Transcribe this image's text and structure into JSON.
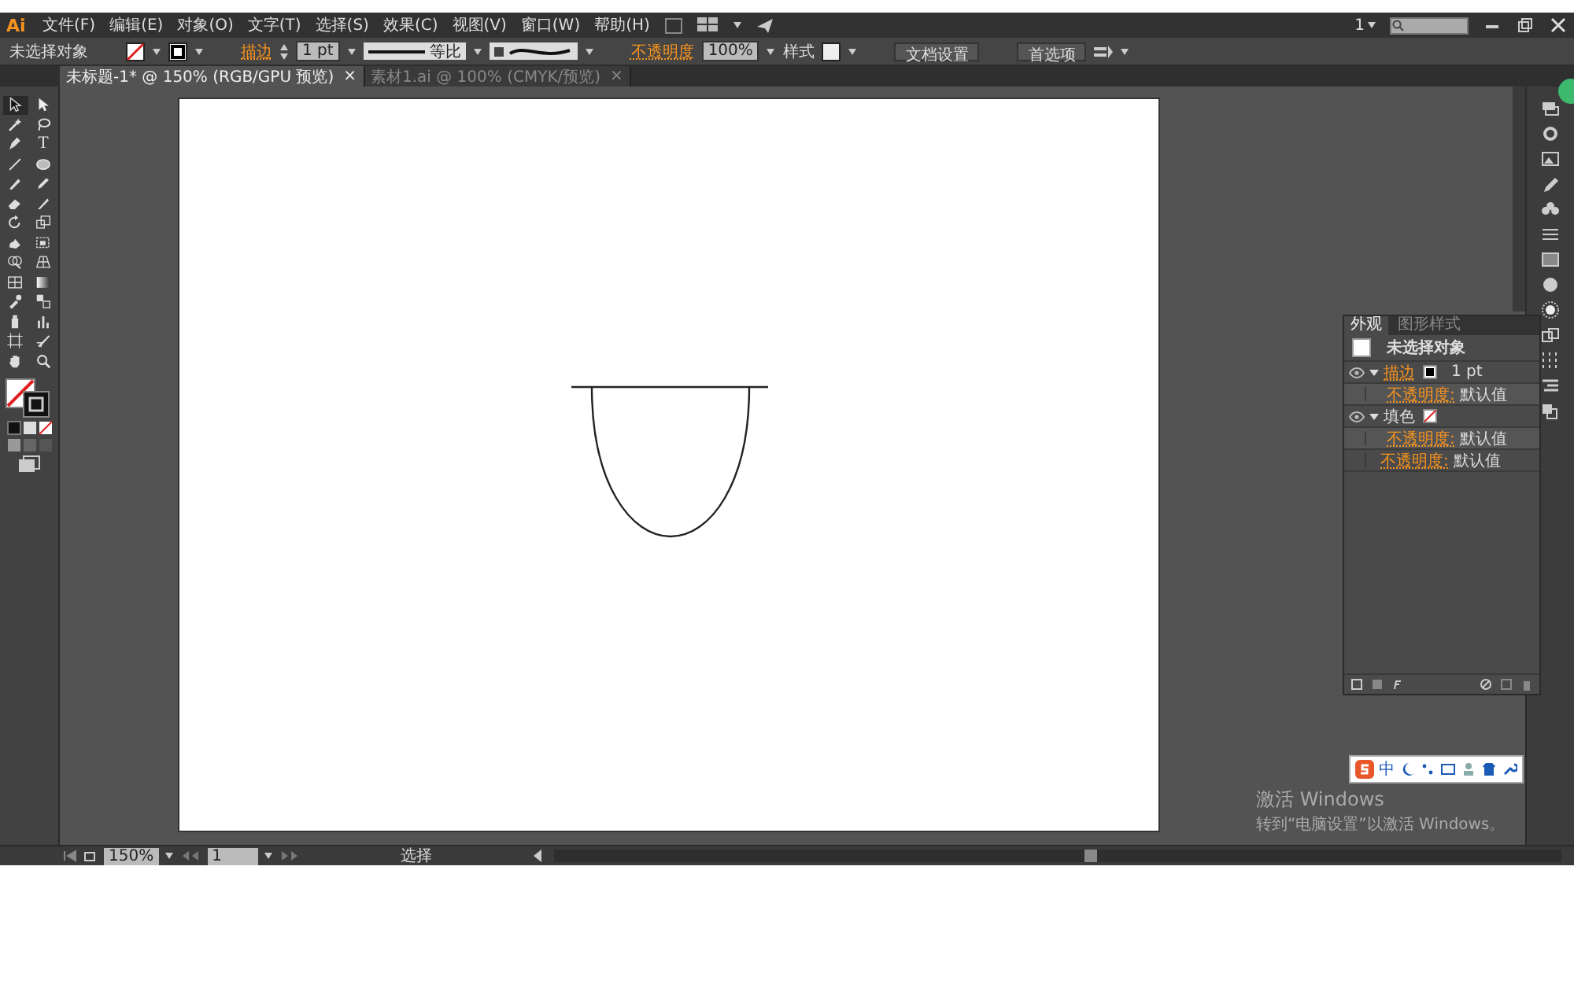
{
  "menu": {
    "logo": "Ai",
    "items": [
      "文件(F)",
      "编辑(E)",
      "对象(O)",
      "文字(T)",
      "选择(S)",
      "效果(C)",
      "视图(V)",
      "窗口(W)",
      "帮助(H)"
    ],
    "workspace_number": "1"
  },
  "control_bar": {
    "selection": "未选择对象",
    "stroke_label": "描边",
    "stroke_weight": "1 pt",
    "profile": "等比",
    "opacity_label": "不透明度",
    "opacity": "100%",
    "style_label": "样式",
    "buttons": [
      "文档设置",
      "首选项"
    ]
  },
  "documents": [
    {
      "title": "未标题-1* @ 150% (RGB/GPU 预览)",
      "close": "×",
      "selected": true
    },
    {
      "title": "素材1.ai @ 100% (CMYK/预览)",
      "close": "×",
      "selected": false
    }
  ],
  "tools": {
    "type_glyph": "T"
  },
  "appearance": {
    "tabs": [
      {
        "label": "外观",
        "selected": true
      },
      {
        "label": "图形样式",
        "selected": false
      }
    ],
    "header": "未选择对象",
    "items": [
      {
        "kind": "stroke",
        "label": "描边",
        "value": "1 pt",
        "expanded": true,
        "children": [
          {
            "label": "不透明度:",
            "value": "默认值"
          }
        ]
      },
      {
        "kind": "fill",
        "label": "填色",
        "expanded": true,
        "children": [
          {
            "label": "不透明度:",
            "value": "默认值"
          }
        ]
      },
      {
        "kind": "opacity",
        "label": "不透明度:",
        "value": "默认值"
      }
    ]
  },
  "status_bar": {
    "zoom": "150%",
    "artboard": "1",
    "tool": "选择"
  },
  "ime": {
    "mode": "中"
  },
  "activation": {
    "title": "激活 Windows",
    "message": "转到“电脑设置”以激活 Windows。"
  }
}
